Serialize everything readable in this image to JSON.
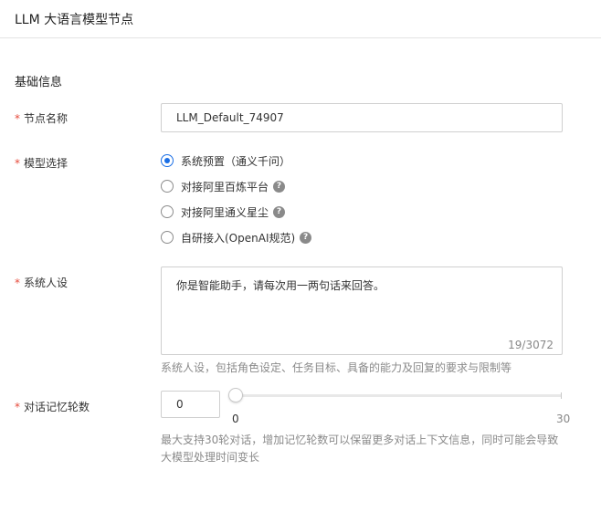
{
  "header": {
    "title": "LLM 大语言模型节点"
  },
  "section": {
    "title": "基础信息"
  },
  "node_name": {
    "label": "节点名称",
    "required_mark": "*",
    "value": "LLM_Default_74907"
  },
  "model_select": {
    "label": "模型选择",
    "required_mark": "*",
    "options": [
      {
        "label": "系统预置（通义千问）",
        "checked": true,
        "help": false
      },
      {
        "label": "对接阿里百炼平台",
        "checked": false,
        "help": true
      },
      {
        "label": "对接阿里通义星尘",
        "checked": false,
        "help": true
      },
      {
        "label": "自研接入(OpenAI规范)",
        "checked": false,
        "help": true
      }
    ],
    "help_glyph": "?"
  },
  "system_persona": {
    "label": "系统人设",
    "required_mark": "*",
    "value": "你是智能助手，请每次用一两句话来回答。",
    "counter": "19/3072",
    "hint": "系统人设，包括角色设定、任务目标、具备的能力及回复的要求与限制等"
  },
  "memory_rounds": {
    "label": "对话记忆轮数",
    "required_mark": "*",
    "value": "0",
    "slider": {
      "min": "0",
      "max": "30",
      "current": 0
    },
    "hint_line1": "最大支持30轮对话，增加记忆轮数可以保留更多对话上下文信息，同时可能会导致",
    "hint_line2": "大模型处理时间变长"
  },
  "colors": {
    "accent": "#1a6ee5",
    "required": "#e6493a",
    "border": "#cfcfcf"
  }
}
